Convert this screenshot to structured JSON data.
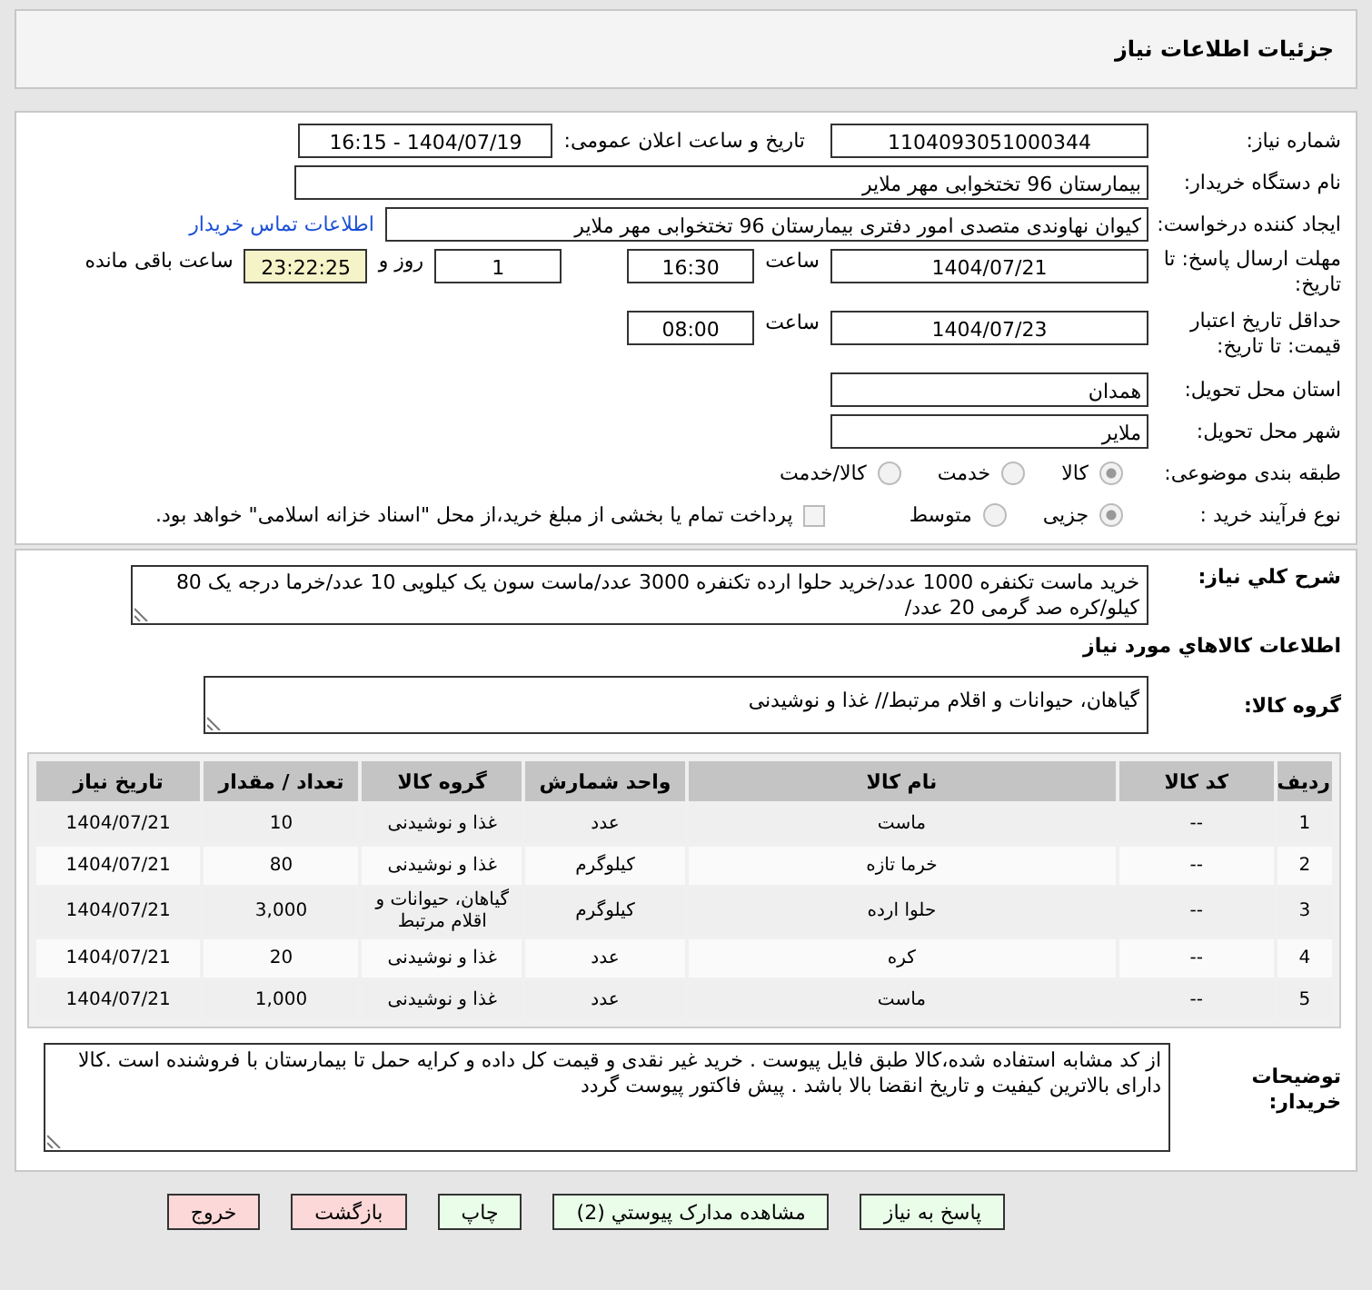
{
  "title": "جزئیات اطلاعات نیاز",
  "need_number": {
    "label": "شماره نیاز:",
    "value": "1104093051000344"
  },
  "announce": {
    "label": "تاریخ و ساعت اعلان عمومی:",
    "value": "1404/07/19 - 16:15"
  },
  "buyer": {
    "label": "نام دستگاه خریدار:",
    "value": "بیمارستان 96 تختخوابی مهر ملایر"
  },
  "creator": {
    "label": "ایجاد کننده درخواست:",
    "value": "کیوان نهاوندی متصدی امور دفتری بیمارستان 96 تختخوابی مهر ملایر",
    "link": "اطلاعات تماس خریدار"
  },
  "deadline": {
    "label": "مهلت ارسال پاسخ: تا تاریخ:",
    "date": "1404/07/21",
    "time_label": "ساعت",
    "time": "16:30",
    "days": "1",
    "days_label": "روز و",
    "remaining": "23:22:25",
    "remaining_label": "ساعت باقی مانده"
  },
  "validity": {
    "label": "حداقل تاریخ اعتبار قیمت: تا تاریخ:",
    "date": "1404/07/23",
    "time_label": "ساعت",
    "time": "08:00"
  },
  "province": {
    "label": "استان محل تحویل:",
    "value": "همدان"
  },
  "city": {
    "label": "شهر محل تحویل:",
    "value": "ملایر"
  },
  "category": {
    "label": "طبقه بندی موضوعی:",
    "options": [
      {
        "label": "کالا",
        "selected": true
      },
      {
        "label": "خدمت",
        "selected": false
      },
      {
        "label": "کالا/خدمت",
        "selected": false
      }
    ]
  },
  "process": {
    "label": "نوع فرآیند خرید :",
    "options": [
      {
        "label": "جزیی",
        "selected": true
      },
      {
        "label": "متوسط",
        "selected": false
      }
    ],
    "treasury": {
      "label": "پرداخت تمام یا بخشی از مبلغ خرید،از محل \"اسناد خزانه اسلامی\" خواهد بود.",
      "checked": false
    }
  },
  "summary": {
    "label": "شرح کلي نياز:",
    "value": "خرید ماست تکنفره 1000 عدد/خرید حلوا ارده تکنفره 3000 عدد/ماست سون یک کیلویی 10 عدد/خرما درجه یک 80 کیلو/کره صد گرمی 20 عدد/"
  },
  "goods_heading": "اطلاعات کالاهاي مورد نياز",
  "goods_group": {
    "label": "گروه کالا:",
    "value": "گیاهان، حیوانات و اقلام مرتبط// غذا و نوشیدنی"
  },
  "table": {
    "columns": [
      "ردیف",
      "کد کالا",
      "نام کالا",
      "واحد شمارش",
      "گروه کالا",
      "تعداد / مقدار",
      "تاریخ نیاز"
    ],
    "rows": [
      [
        "1",
        "--",
        "ماست",
        "عدد",
        "غذا و نوشیدنی",
        "10",
        "1404/07/21"
      ],
      [
        "2",
        "--",
        "خرما تازه",
        "کیلوگرم",
        "غذا و نوشیدنی",
        "80",
        "1404/07/21"
      ],
      [
        "3",
        "--",
        "حلوا ارده",
        "کیلوگرم",
        "گیاهان، حیوانات و اقلام مرتبط",
        "3,000",
        "1404/07/21"
      ],
      [
        "4",
        "--",
        "کره",
        "عدد",
        "غذا و نوشیدنی",
        "20",
        "1404/07/21"
      ],
      [
        "5",
        "--",
        "ماست",
        "عدد",
        "غذا و نوشیدنی",
        "1,000",
        "1404/07/21"
      ]
    ]
  },
  "notes": {
    "label": "توضیحات خریدار:",
    "value": "از کد مشابه استفاده شده،کالا طبق فایل پیوست . خرید غیر نقدی و قیمت کل داده و کرایه حمل تا بیمارستان با فروشنده است .کالا دارای بالاترین کیفیت و تاریخ انقضا بالا باشد .   پیش فاکتور پیوست گردد"
  },
  "buttons": [
    {
      "label": "پاسخ به نیاز",
      "kind": "normal"
    },
    {
      "label": "مشاهده مدارک پیوستي (2)",
      "kind": "normal"
    },
    {
      "label": "چاپ",
      "kind": "normal"
    },
    {
      "label": "بازگشت",
      "kind": "exit"
    },
    {
      "label": "خروج",
      "kind": "exit"
    }
  ]
}
